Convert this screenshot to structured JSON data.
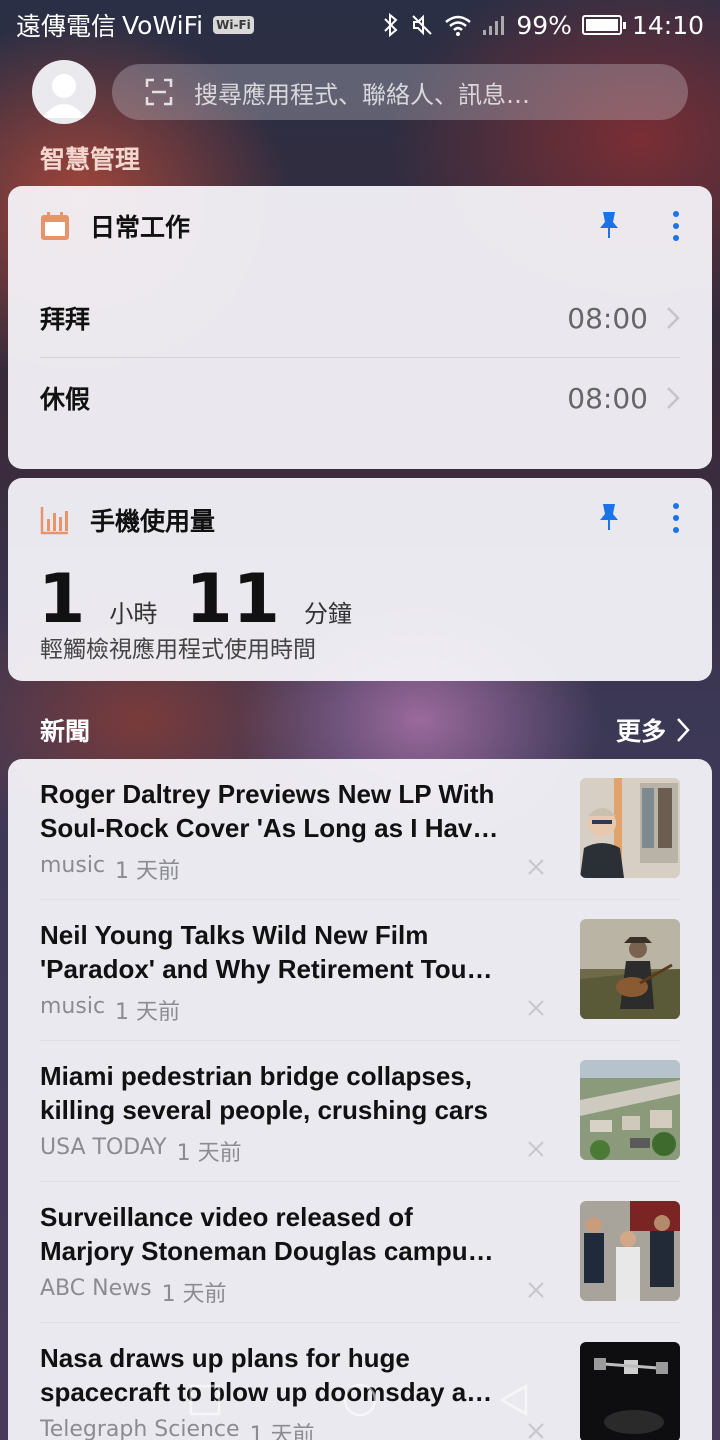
{
  "status_bar": {
    "carrier": "遠傳電信",
    "network": "VoWiFi",
    "wifi_badge": "Wi-Fi",
    "battery": "99%",
    "battery_level": 0.99,
    "time": "14:10"
  },
  "search": {
    "placeholder": "搜尋應用程式、聯絡人、訊息…"
  },
  "smart_section": {
    "title": "智慧管理"
  },
  "routine_card": {
    "title": "日常工作",
    "items": [
      {
        "label": "拜拜",
        "time": "08:00"
      },
      {
        "label": "休假",
        "time": "08:00"
      }
    ]
  },
  "usage_card": {
    "title": "手機使用量",
    "hours": "1",
    "hours_unit": "小時",
    "minutes": "11",
    "minutes_unit": "分鐘",
    "subtitle": "輕觸檢視應用程式使用時間"
  },
  "news": {
    "title": "新聞",
    "more": "更多",
    "items": [
      {
        "line1": "Roger Daltrey Previews New LP With",
        "line2": "Soul-Rock Cover 'As Long as I Hav…",
        "source": "music",
        "age": "1 天前"
      },
      {
        "line1": "Neil Young Talks Wild New Film",
        "line2": "'Paradox' and Why Retirement Tou…",
        "source": "music",
        "age": "1 天前"
      },
      {
        "line1": "Miami pedestrian bridge collapses,",
        "line2": "killing several people, crushing cars",
        "source": "USA TODAY",
        "age": "1 天前"
      },
      {
        "line1": "Surveillance video released of",
        "line2": "Marjory Stoneman Douglas campu…",
        "source": "ABC News",
        "age": "1 天前"
      },
      {
        "line1": "Nasa draws up plans for huge",
        "line2": "spacecraft to blow up doomsday a…",
        "source": "Telegraph Science",
        "age": "1 天前"
      }
    ]
  },
  "colors": {
    "accent_pin": "#1a73e8",
    "routine_icon": "#e8946a",
    "usage_icon": "#e8946a"
  }
}
